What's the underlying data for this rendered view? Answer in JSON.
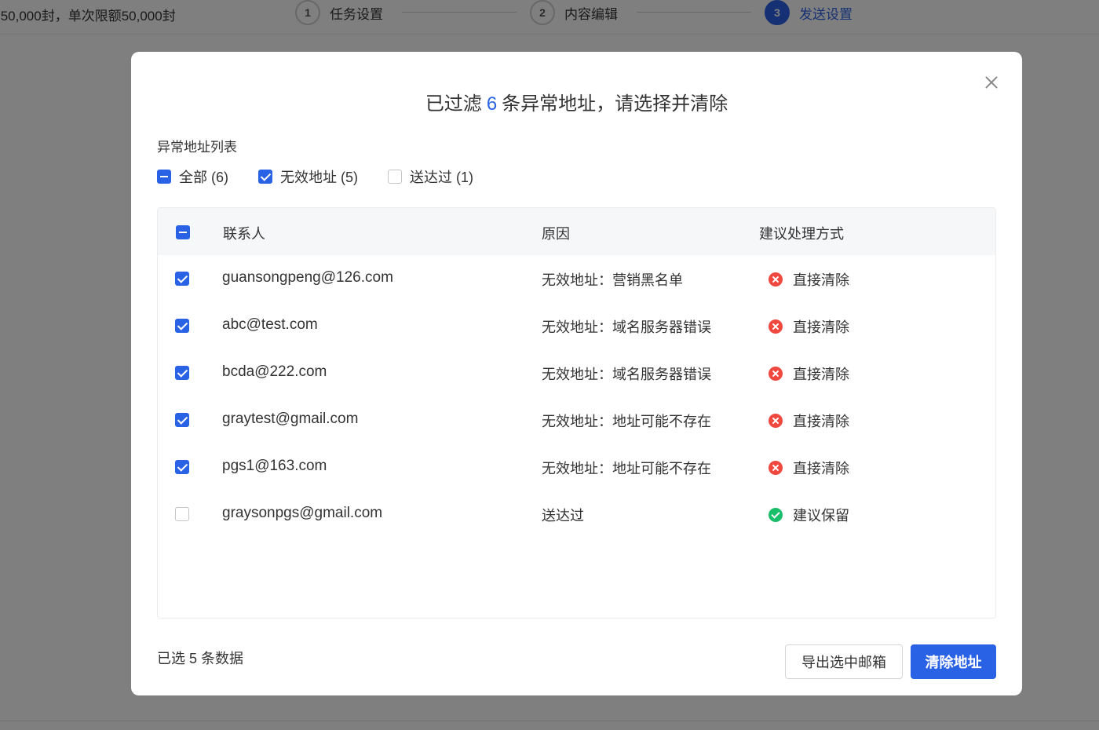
{
  "background": {
    "quota_text": ":50,000封，单次限额50,000封",
    "steps": [
      {
        "num": "1",
        "label": "任务设置"
      },
      {
        "num": "2",
        "label": "内容编辑"
      },
      {
        "num": "3",
        "label": "发送设置"
      }
    ]
  },
  "modal": {
    "title_prefix": "已过滤",
    "title_count": "6",
    "title_suffix": "条异常地址，请选择并清除",
    "section_label": "异常地址列表",
    "filters": [
      {
        "label": "全部 (6)",
        "state": "indeterminate"
      },
      {
        "label": "无效地址 (5)",
        "state": "checked"
      },
      {
        "label": "送达过 (1)",
        "state": "unchecked"
      }
    ],
    "table": {
      "headers": {
        "contact": "联系人",
        "reason": "原因",
        "action": "建议处理方式"
      },
      "rows": [
        {
          "contact": "guansongpeng@126.com",
          "reason": "无效地址：营销黑名单",
          "action": "直接清除",
          "checked": true,
          "status": "err"
        },
        {
          "contact": "abc@test.com",
          "reason": "无效地址：域名服务器错误",
          "action": "直接清除",
          "checked": true,
          "status": "err"
        },
        {
          "contact": "bcda@222.com",
          "reason": "无效地址：域名服务器错误",
          "action": "直接清除",
          "checked": true,
          "status": "err"
        },
        {
          "contact": "graytest@gmail.com",
          "reason": "无效地址：地址可能不存在",
          "action": "直接清除",
          "checked": true,
          "status": "err"
        },
        {
          "contact": "pgs1@163.com",
          "reason": "无效地址：地址可能不存在",
          "action": "直接清除",
          "checked": true,
          "status": "err"
        },
        {
          "contact": "graysonpgs@gmail.com",
          "reason": "送达过",
          "action": "建议保留",
          "checked": false,
          "status": "ok"
        }
      ]
    },
    "selected_count_text": "已选 5 条数据",
    "export_button": "导出选中邮箱",
    "clear_button": "清除地址"
  },
  "colors": {
    "accent": "#2a62e6",
    "error": "#f0473f",
    "success": "#19be6b"
  }
}
